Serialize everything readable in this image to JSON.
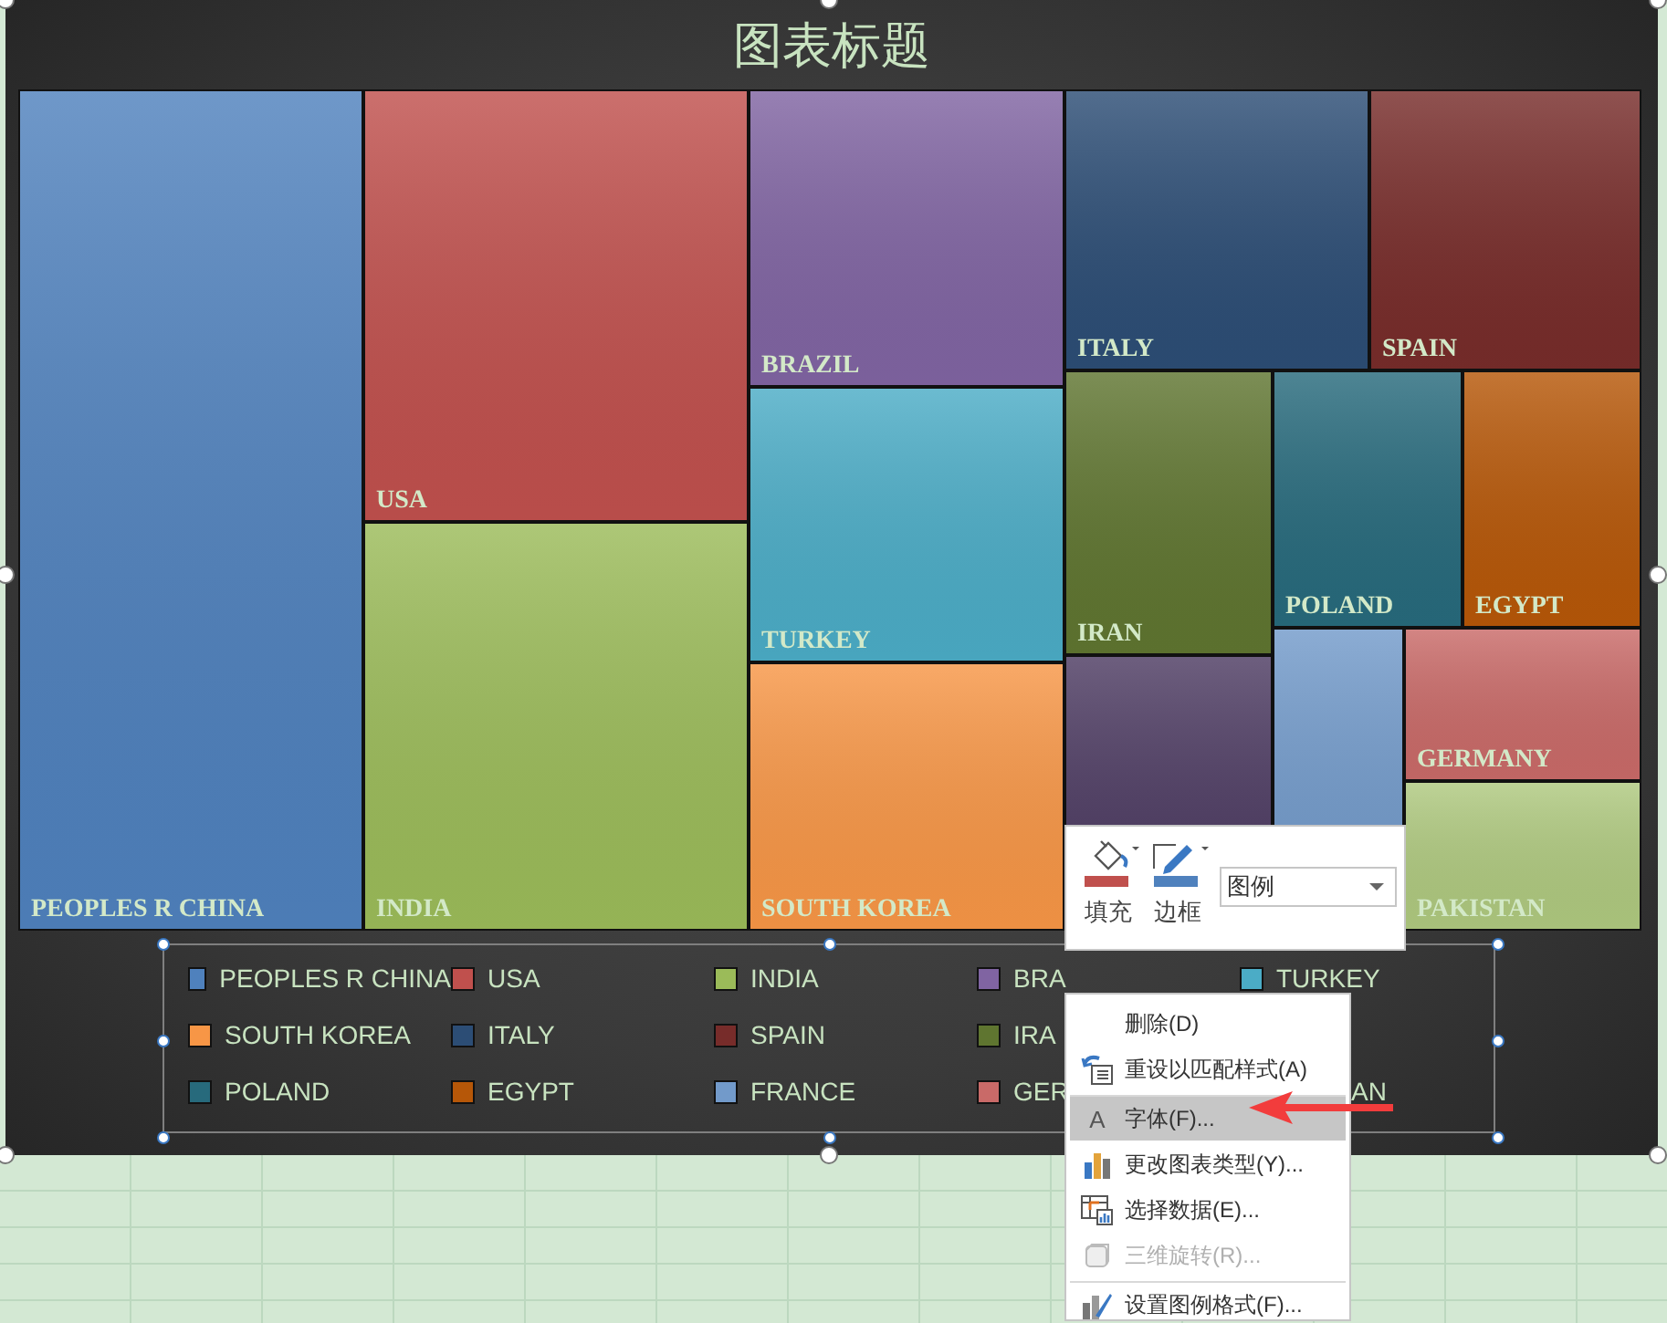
{
  "chart": {
    "title": "图表标题"
  },
  "treemap": {
    "tiles": [
      {
        "label": "PEOPLES R CHINA",
        "color": "#4f81bd"
      },
      {
        "label": "USA",
        "color": "#c0504d"
      },
      {
        "label": "INDIA",
        "color": "#9bbb59"
      },
      {
        "label": "BRAZIL",
        "color": "#8064a2"
      },
      {
        "label": "TURKEY",
        "color": "#4bacc6"
      },
      {
        "label": "SOUTH KOREA",
        "color": "#f79646"
      },
      {
        "label": "ITALY",
        "color": "#2c4d75"
      },
      {
        "label": "SPAIN",
        "color": "#772c2a"
      },
      {
        "label": "IRAN",
        "color": "#5f7530"
      },
      {
        "label": "POLAND",
        "color": "#276a7c"
      },
      {
        "label": "EGYPT",
        "color": "#b65708"
      },
      {
        "color": "#4d3b62"
      },
      {
        "color": "#729aca"
      },
      {
        "label": "GERMANY",
        "color": "#c96a68"
      },
      {
        "label": "PAKISTAN",
        "color": "#afc97f"
      }
    ]
  },
  "legend": {
    "rows": [
      [
        {
          "label": "PEOPLES R CHINA",
          "color": "#4f81bd"
        },
        {
          "label": "USA",
          "color": "#c0504d"
        },
        {
          "label": "INDIA",
          "color": "#9bbb59"
        },
        {
          "label": "BRA",
          "color": "#8064a2"
        },
        {
          "label": "TURKEY",
          "color": "#4bacc6"
        }
      ],
      [
        {
          "label": "SOUTH KOREA",
          "color": "#f79646"
        },
        {
          "label": "ITALY",
          "color": "#2c4d75"
        },
        {
          "label": "SPAIN",
          "color": "#772c2a"
        },
        {
          "label": "IRA",
          "color": "#5f7530"
        }
      ],
      [
        {
          "label": "POLAND",
          "color": "#276a7c"
        },
        {
          "label": "EGYPT",
          "color": "#b65708"
        },
        {
          "label": "FRANCE",
          "color": "#729aca"
        },
        {
          "label": "GER",
          "color": "#c96a68"
        },
        {
          "label": "AN"
        }
      ]
    ]
  },
  "format_toolbar": {
    "fill_label": "填充",
    "border_label": "边框",
    "element": "图例"
  },
  "context_menu": [
    {
      "label": "删除(D)",
      "kind": "none",
      "selected": false,
      "disabled": false,
      "separator_before": false
    },
    {
      "label": "重设以匹配样式(A)",
      "kind": "reset",
      "selected": false,
      "disabled": false,
      "separator_before": false
    },
    {
      "label": "字体(F)...",
      "kind": "font",
      "icon": "A",
      "selected": true,
      "disabled": false,
      "separator_before": true
    },
    {
      "label": "更改图表类型(Y)...",
      "kind": "chart",
      "selected": false,
      "disabled": false,
      "separator_before": false
    },
    {
      "label": "选择数据(E)...",
      "kind": "data",
      "selected": false,
      "disabled": false,
      "separator_before": false
    },
    {
      "label": "三维旋转(R)...",
      "kind": "rotate",
      "selected": false,
      "disabled": true,
      "separator_before": false
    },
    {
      "label": "设置图例格式(F)...",
      "kind": "format",
      "selected": false,
      "disabled": false,
      "separator_before": true
    }
  ]
}
